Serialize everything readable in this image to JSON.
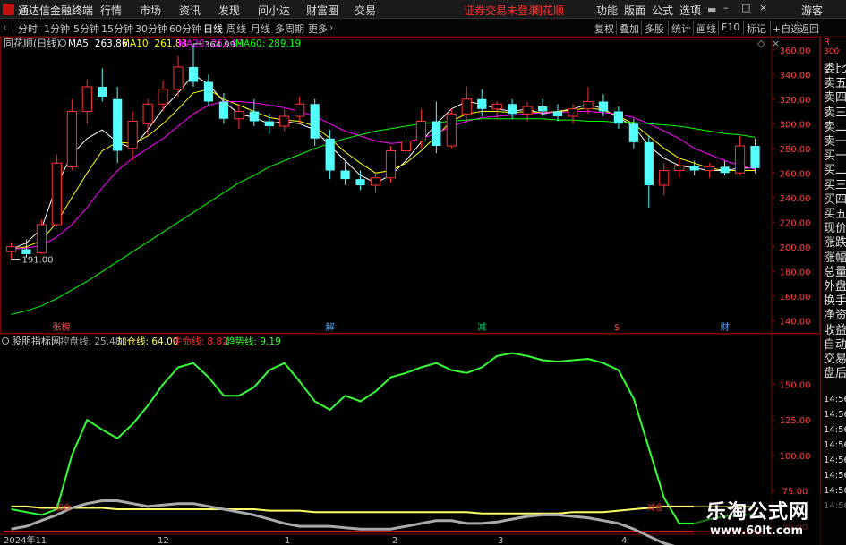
{
  "menubar": {
    "app_title": "通达信金融终端",
    "menus": [
      "行情",
      "市场",
      "资讯",
      "发现",
      "问小达",
      "财富圈",
      "交易"
    ],
    "notice": "证券交易未登录",
    "stock_name": "同花顺",
    "right_menus": [
      "功能",
      "版面",
      "公式",
      "选项"
    ],
    "user": "游客"
  },
  "periodbar": {
    "periods": [
      "分时",
      "1分钟",
      "5分钟",
      "15分钟",
      "30分钟",
      "60分钟",
      "日线",
      "周线",
      "月线",
      "多周期",
      "更多"
    ],
    "active": "日线",
    "tools": [
      "复权",
      "叠加",
      "多股",
      "统计",
      "画线",
      "F10",
      "标记",
      "+自选",
      "返回"
    ]
  },
  "main_chart": {
    "title": "同花顺(日线)",
    "ma_labels": [
      "MA5: 263.86",
      "MA10: 261.83",
      "MA20: 262.99",
      "MA60: 289.19"
    ],
    "ma_colors": [
      "#ffffff",
      "#ffff00",
      "#ff00ff",
      "#00ff00"
    ],
    "high_label": "364.99",
    "low_label": "191.00",
    "event_tags": [
      {
        "text": "张榜",
        "color": "#ff4040"
      },
      {
        "text": "解",
        "color": "#4da6ff"
      },
      {
        "text": "减",
        "color": "#00cc66"
      },
      {
        "text": "$",
        "color": "#ff4040"
      },
      {
        "text": "财",
        "color": "#4da6ff"
      }
    ]
  },
  "indicator": {
    "name": "股朋指标网",
    "labels": [
      "控盘线: 25.48",
      "加仓线: 64.00",
      "生命线: 8.82",
      "趋势线: 9.19"
    ],
    "label_colors": [
      "#aaaaaa",
      "#ffff66",
      "#ff3333",
      "#33ff33"
    ],
    "marks": [
      "加仓",
      "减仓"
    ]
  },
  "x_axis": {
    "labels": [
      "2024年11",
      "12",
      "1",
      "2",
      "3",
      "4"
    ]
  },
  "right_panel": {
    "top": "R",
    "top_num": "300",
    "items": [
      "委比",
      "卖五",
      "卖四",
      "卖三",
      "卖二",
      "卖一",
      "买一",
      "买二",
      "买三",
      "买四",
      "买五",
      "现价",
      "涨跌",
      "涨幅",
      "总量",
      "外盘",
      "换手",
      "净资",
      "收益",
      "自动",
      "交易",
      "盘后"
    ],
    "times": [
      "14:56",
      "14:56",
      "14:56",
      "14:56",
      "14:56",
      "14:56",
      "14:56",
      "14:56"
    ]
  },
  "watermark": {
    "title": "乐淘公式网",
    "url": "www.60lt.com"
  },
  "chart_data": [
    {
      "type": "candlestick",
      "title": "同花顺(日线)",
      "ylim": [
        130,
        370
      ],
      "yticks": [
        140,
        160,
        180,
        200,
        220,
        240,
        260,
        280,
        300,
        320,
        340,
        360
      ],
      "x_labels": [
        "2024年11",
        "12",
        "1",
        "2",
        "3",
        "4"
      ],
      "series": [
        {
          "name": "MA5",
          "values": [
            198,
            203,
            215,
            250,
            275,
            288,
            295,
            285,
            280,
            295,
            312,
            325,
            340,
            332,
            318,
            308,
            305,
            300,
            302,
            300,
            295,
            282,
            270,
            258,
            252,
            258,
            270,
            285,
            300,
            312,
            318,
            316,
            312,
            310,
            312,
            308,
            310,
            312,
            316,
            312,
            305,
            298,
            282,
            272,
            266,
            264,
            262,
            262,
            264,
            264
          ]
        },
        {
          "name": "MA10",
          "values": [
            198,
            200,
            205,
            220,
            240,
            260,
            278,
            285,
            284,
            290,
            300,
            312,
            325,
            328,
            320,
            315,
            310,
            305,
            303,
            302,
            298,
            288,
            277,
            268,
            260,
            262,
            268,
            278,
            290,
            302,
            308,
            310,
            310,
            309,
            310,
            309,
            310,
            311,
            313,
            311,
            306,
            300,
            290,
            280,
            272,
            268,
            264,
            262,
            262,
            262
          ]
        },
        {
          "name": "MA20",
          "values": [
            198,
            199,
            201,
            208,
            218,
            232,
            248,
            262,
            272,
            280,
            288,
            298,
            308,
            315,
            318,
            318,
            317,
            315,
            313,
            310,
            306,
            300,
            294,
            290,
            286,
            284,
            285,
            288,
            292,
            298,
            302,
            305,
            306,
            307,
            308,
            309,
            309,
            310,
            310,
            309,
            308,
            305,
            300,
            294,
            288,
            280,
            275,
            270,
            266,
            263
          ]
        },
        {
          "name": "MA60",
          "values": [
            145,
            148,
            152,
            158,
            165,
            172,
            180,
            188,
            196,
            204,
            212,
            220,
            228,
            236,
            244,
            252,
            258,
            265,
            270,
            275,
            280,
            284,
            288,
            291,
            294,
            296,
            298,
            300,
            301,
            302,
            303,
            304,
            304,
            304,
            304,
            304,
            303,
            303,
            302,
            302,
            301,
            301,
            300,
            299,
            298,
            296,
            294,
            292,
            291,
            289
          ]
        }
      ],
      "candles": [
        {
          "o": 196,
          "h": 203,
          "l": 190,
          "c": 200
        },
        {
          "o": 198,
          "h": 206,
          "l": 191,
          "c": 194
        },
        {
          "o": 195,
          "h": 222,
          "l": 194,
          "c": 218
        },
        {
          "o": 218,
          "h": 275,
          "l": 216,
          "c": 268
        },
        {
          "o": 265,
          "h": 320,
          "l": 262,
          "c": 310
        },
        {
          "o": 310,
          "h": 336,
          "l": 300,
          "c": 330
        },
        {
          "o": 330,
          "h": 345,
          "l": 318,
          "c": 322
        },
        {
          "o": 320,
          "h": 330,
          "l": 268,
          "c": 278
        },
        {
          "o": 280,
          "h": 310,
          "l": 270,
          "c": 302
        },
        {
          "o": 300,
          "h": 320,
          "l": 290,
          "c": 316
        },
        {
          "o": 316,
          "h": 335,
          "l": 310,
          "c": 328
        },
        {
          "o": 328,
          "h": 355,
          "l": 322,
          "c": 346
        },
        {
          "o": 346,
          "h": 365,
          "l": 330,
          "c": 334
        },
        {
          "o": 334,
          "h": 340,
          "l": 315,
          "c": 318
        },
        {
          "o": 318,
          "h": 325,
          "l": 300,
          "c": 304
        },
        {
          "o": 304,
          "h": 316,
          "l": 296,
          "c": 310
        },
        {
          "o": 310,
          "h": 320,
          "l": 298,
          "c": 302
        },
        {
          "o": 302,
          "h": 308,
          "l": 292,
          "c": 298
        },
        {
          "o": 298,
          "h": 312,
          "l": 294,
          "c": 306
        },
        {
          "o": 306,
          "h": 322,
          "l": 300,
          "c": 316
        },
        {
          "o": 316,
          "h": 320,
          "l": 282,
          "c": 288
        },
        {
          "o": 288,
          "h": 295,
          "l": 255,
          "c": 262
        },
        {
          "o": 262,
          "h": 270,
          "l": 250,
          "c": 255
        },
        {
          "o": 255,
          "h": 262,
          "l": 246,
          "c": 250
        },
        {
          "o": 250,
          "h": 260,
          "l": 244,
          "c": 256
        },
        {
          "o": 256,
          "h": 282,
          "l": 252,
          "c": 278
        },
        {
          "o": 278,
          "h": 292,
          "l": 270,
          "c": 286
        },
        {
          "o": 286,
          "h": 312,
          "l": 280,
          "c": 302
        },
        {
          "o": 302,
          "h": 318,
          "l": 276,
          "c": 282
        },
        {
          "o": 282,
          "h": 312,
          "l": 280,
          "c": 308
        },
        {
          "o": 308,
          "h": 330,
          "l": 300,
          "c": 320
        },
        {
          "o": 320,
          "h": 328,
          "l": 306,
          "c": 312
        },
        {
          "o": 312,
          "h": 318,
          "l": 304,
          "c": 316
        },
        {
          "o": 316,
          "h": 320,
          "l": 304,
          "c": 308
        },
        {
          "o": 308,
          "h": 318,
          "l": 302,
          "c": 314
        },
        {
          "o": 314,
          "h": 320,
          "l": 306,
          "c": 310
        },
        {
          "o": 310,
          "h": 316,
          "l": 302,
          "c": 306
        },
        {
          "o": 306,
          "h": 316,
          "l": 300,
          "c": 312
        },
        {
          "o": 312,
          "h": 330,
          "l": 308,
          "c": 318
        },
        {
          "o": 318,
          "h": 324,
          "l": 306,
          "c": 310
        },
        {
          "o": 310,
          "h": 314,
          "l": 296,
          "c": 300
        },
        {
          "o": 300,
          "h": 304,
          "l": 280,
          "c": 285
        },
        {
          "o": 285,
          "h": 290,
          "l": 232,
          "c": 250
        },
        {
          "o": 250,
          "h": 268,
          "l": 242,
          "c": 262
        },
        {
          "o": 262,
          "h": 272,
          "l": 256,
          "c": 266
        },
        {
          "o": 266,
          "h": 270,
          "l": 258,
          "c": 262
        },
        {
          "o": 262,
          "h": 268,
          "l": 256,
          "c": 265
        },
        {
          "o": 265,
          "h": 270,
          "l": 258,
          "c": 260
        },
        {
          "o": 260,
          "h": 290,
          "l": 258,
          "c": 282
        },
        {
          "o": 282,
          "h": 288,
          "l": 260,
          "c": 264
        }
      ]
    },
    {
      "type": "line",
      "title": "股朋指标网",
      "ylim": [
        45,
        185
      ],
      "yticks": [
        50,
        75,
        100,
        125,
        150
      ],
      "series": [
        {
          "name": "趋势线",
          "color": "#33ff33",
          "values": [
            62,
            60,
            58,
            62,
            100,
            125,
            118,
            112,
            122,
            135,
            150,
            162,
            165,
            155,
            142,
            142,
            148,
            160,
            165,
            152,
            138,
            132,
            142,
            138,
            145,
            155,
            158,
            162,
            165,
            160,
            158,
            162,
            170,
            172,
            170,
            167,
            166,
            167,
            168,
            165,
            160,
            140,
            105,
            70,
            52,
            52,
            55,
            57,
            58,
            58
          ]
        },
        {
          "name": "加仓线",
          "color": "#ffff66",
          "values": [
            64,
            64,
            63,
            63,
            63,
            63,
            63,
            62,
            62,
            62,
            62,
            62,
            62,
            62,
            62,
            62,
            62,
            61,
            61,
            61,
            60,
            60,
            60,
            60,
            60,
            60,
            60,
            60,
            60,
            60,
            60,
            59,
            59,
            59,
            59,
            59,
            59,
            60,
            60,
            60,
            61,
            62,
            63,
            64,
            64,
            64,
            64,
            64,
            64,
            64
          ]
        },
        {
          "name": "控盘线",
          "color": "#aaaaaa",
          "values": [
            48,
            50,
            54,
            58,
            63,
            66,
            68,
            68,
            66,
            64,
            65,
            66,
            66,
            64,
            62,
            60,
            58,
            55,
            52,
            50,
            50,
            50,
            49,
            48,
            48,
            48,
            50,
            52,
            54,
            54,
            52,
            52,
            53,
            55,
            57,
            58,
            58,
            57,
            56,
            54,
            52,
            48,
            43,
            38,
            35,
            34,
            34,
            34,
            34,
            34
          ]
        }
      ]
    }
  ]
}
